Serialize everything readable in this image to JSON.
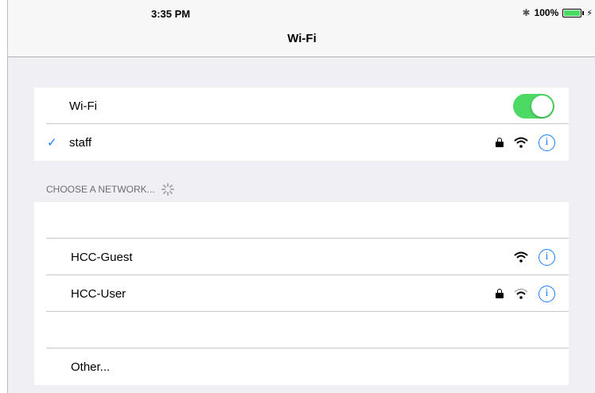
{
  "status_bar": {
    "time": "3:35 PM",
    "bluetooth_icon": "bluetooth-icon",
    "battery_text": "100%"
  },
  "navbar": {
    "title": "Wi-Fi"
  },
  "wifi_toggle": {
    "label": "Wi-Fi",
    "on": true,
    "color": "#4cd964"
  },
  "connected": {
    "name": "staff",
    "secured": true
  },
  "section_header": "CHOOSE A NETWORK...",
  "networks": [
    {
      "name": "",
      "secured": false
    },
    {
      "name": "HCC-Guest",
      "secured": false
    },
    {
      "name": "HCC-User",
      "secured": true
    },
    {
      "name": "",
      "secured": false
    },
    {
      "name": "Other...",
      "secured": false
    }
  ],
  "accent_color": "#1a7cf5",
  "info_glyph": "i",
  "check_glyph": "✓"
}
